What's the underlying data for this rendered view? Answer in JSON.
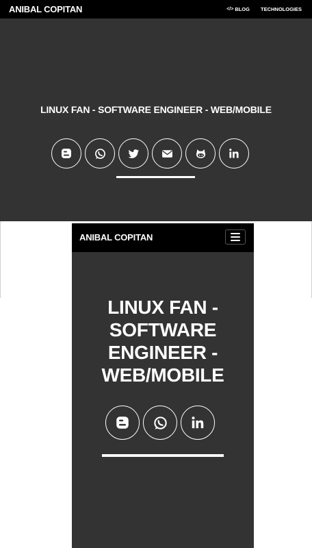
{
  "desktop": {
    "brand": "ANIBAL COPITAN",
    "nav": [
      {
        "label": "BLOG",
        "icon": "code-icon"
      },
      {
        "label": "TECHNOLOGIES"
      }
    ],
    "headline": "LINUX FAN - SOFTWARE ENGINEER - WEB/MOBILE",
    "social_icons": [
      "blogger-icon",
      "whatsapp-icon",
      "twitter-icon",
      "envelope-icon",
      "github-icon",
      "linkedin-icon"
    ]
  },
  "mobile": {
    "brand": "ANIBAL COPITAN",
    "menu_icon": "hamburger-menu-icon",
    "headline_lines": [
      "LINUX FAN -",
      "SOFTWARE",
      "ENGINEER -",
      "WEB/MOBILE"
    ],
    "social_icons": [
      "blogger-icon",
      "whatsapp-icon",
      "linkedin-icon"
    ]
  },
  "colors": {
    "nav_background": "#000000",
    "hero_background": "#333333",
    "text": "#ffffff",
    "page_background": "#ffffff"
  }
}
